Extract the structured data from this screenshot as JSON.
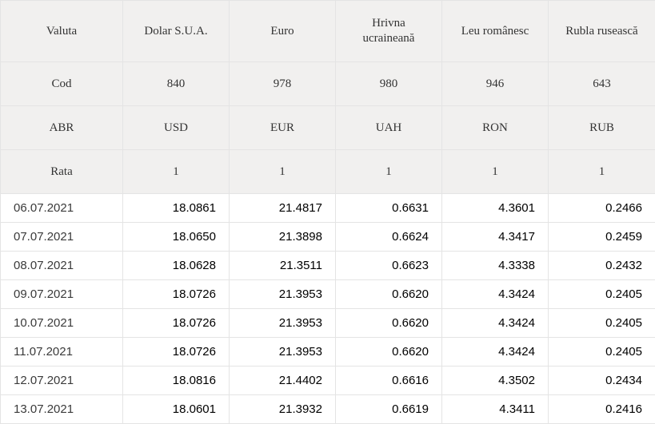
{
  "header": {
    "label_valuta": "Valuta",
    "label_cod": "Cod",
    "label_abr": "ABR",
    "label_rata": "Rata",
    "currencies": [
      {
        "name": "Dolar S.U.A.",
        "code": "840",
        "abr": "USD",
        "rate_unit": "1"
      },
      {
        "name": "Euro",
        "code": "978",
        "abr": "EUR",
        "rate_unit": "1"
      },
      {
        "name": "Hrivna ucraineană",
        "code": "980",
        "abr": "UAH",
        "rate_unit": "1"
      },
      {
        "name": "Leu românesc",
        "code": "946",
        "abr": "RON",
        "rate_unit": "1"
      },
      {
        "name": "Rubla rusească",
        "code": "643",
        "abr": "RUB",
        "rate_unit": "1"
      }
    ]
  },
  "rows": [
    {
      "date": "06.07.2021",
      "values": [
        "18.0861",
        "21.4817",
        "0.6631",
        "4.3601",
        "0.2466"
      ]
    },
    {
      "date": "07.07.2021",
      "values": [
        "18.0650",
        "21.3898",
        "0.6624",
        "4.3417",
        "0.2459"
      ]
    },
    {
      "date": "08.07.2021",
      "values": [
        "18.0628",
        "21.3511",
        "0.6623",
        "4.3338",
        "0.2432"
      ]
    },
    {
      "date": "09.07.2021",
      "values": [
        "18.0726",
        "21.3953",
        "0.6620",
        "4.3424",
        "0.2405"
      ]
    },
    {
      "date": "10.07.2021",
      "values": [
        "18.0726",
        "21.3953",
        "0.6620",
        "4.3424",
        "0.2405"
      ]
    },
    {
      "date": "11.07.2021",
      "values": [
        "18.0726",
        "21.3953",
        "0.6620",
        "4.3424",
        "0.2405"
      ]
    },
    {
      "date": "12.07.2021",
      "values": [
        "18.0816",
        "21.4402",
        "0.6616",
        "4.3502",
        "0.2434"
      ]
    },
    {
      "date": "13.07.2021",
      "values": [
        "18.0601",
        "21.3932",
        "0.6619",
        "4.3411",
        "0.2416"
      ]
    }
  ]
}
